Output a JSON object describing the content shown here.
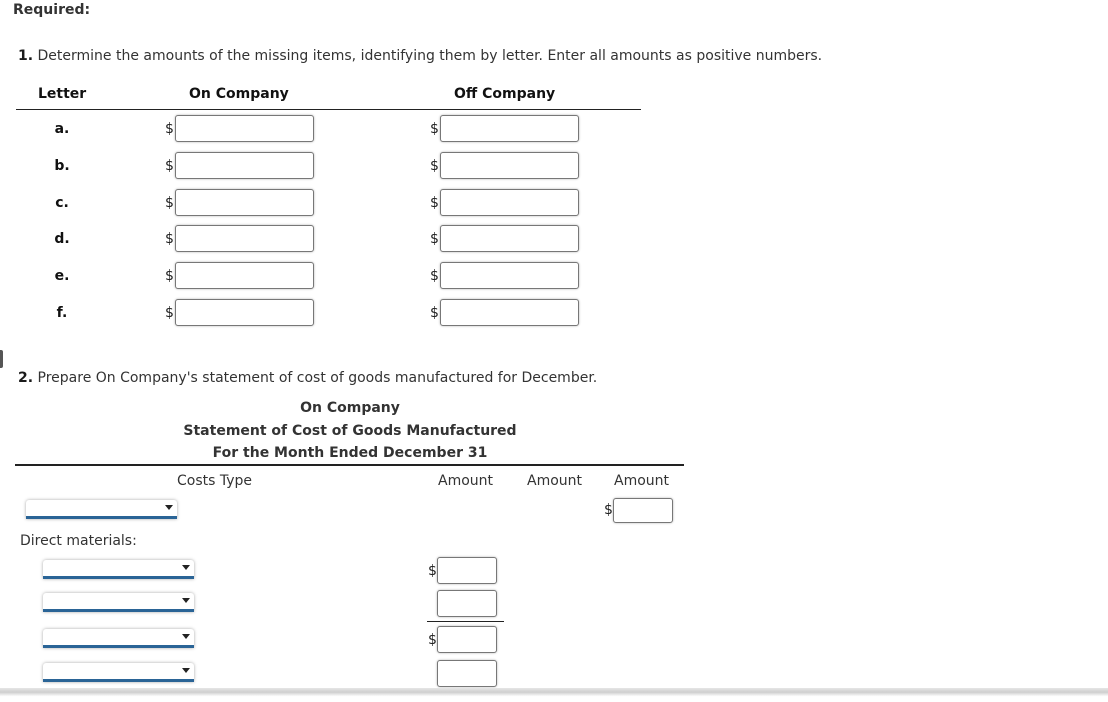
{
  "required_label": "Required:",
  "part1": {
    "number": "1.",
    "instruction": "Determine the amounts of the missing items, identifying them by letter. Enter all amounts as positive numbers.",
    "headers": {
      "letter": "Letter",
      "on_company": "On Company",
      "off_company": "Off Company"
    },
    "currency_symbol": "$",
    "rows": [
      {
        "letter": "a.",
        "on_value": "",
        "off_value": ""
      },
      {
        "letter": "b.",
        "on_value": "",
        "off_value": ""
      },
      {
        "letter": "c.",
        "on_value": "",
        "off_value": ""
      },
      {
        "letter": "d.",
        "on_value": "",
        "off_value": ""
      },
      {
        "letter": "e.",
        "on_value": "",
        "off_value": ""
      },
      {
        "letter": "f.",
        "on_value": "",
        "off_value": ""
      }
    ]
  },
  "part2": {
    "number": "2.",
    "instruction": "Prepare On Company's statement of cost of goods manufactured for December.",
    "company": "On Company",
    "statement_title": "Statement of Cost of Goods Manufactured",
    "period": "For the Month Ended December 31",
    "headers": {
      "costs_type": "Costs Type",
      "amount1": "Amount",
      "amount2": "Amount",
      "amount3": "Amount"
    },
    "currency_symbol": "$",
    "first_row": {
      "selected": "",
      "amount3_value": ""
    },
    "direct_materials_label": "Direct materials:",
    "dm_rows": [
      {
        "selected": "",
        "amount_value": "",
        "show_dollar": true
      },
      {
        "selected": "",
        "amount_value": "",
        "show_dollar": false
      },
      {
        "selected": "",
        "amount_value": "",
        "show_dollar": true
      },
      {
        "selected": "",
        "amount_value": "",
        "show_dollar": false
      }
    ]
  }
}
